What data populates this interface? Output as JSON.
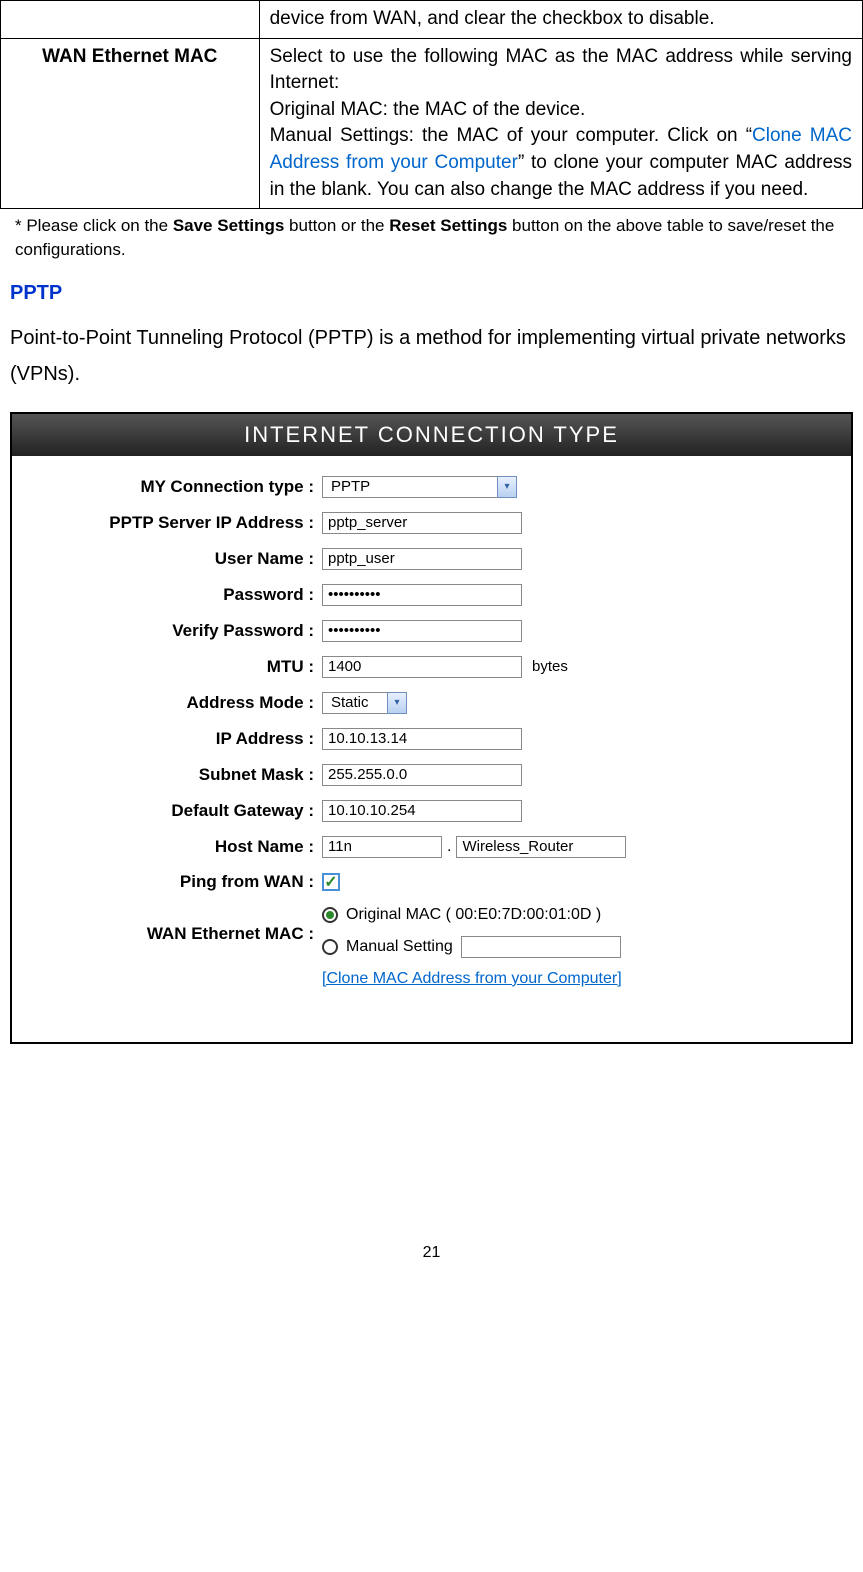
{
  "table": {
    "row1_desc": "device from WAN, and clear the checkbox to disable.",
    "row2_label": "WAN Ethernet MAC",
    "row2_desc_part1": "Select to use the following MAC as the MAC address while serving Internet:",
    "row2_desc_part2": "Original MAC: the MAC of the device.",
    "row2_desc_part3a": "Manual Settings: the MAC of your computer. Click on “",
    "row2_link": "Clone MAC Address from your Computer",
    "row2_desc_part3b": "” to clone your computer MAC address in the blank. You can also change the MAC address if you need."
  },
  "note_part1": "* Please click on the ",
  "note_bold1": "Save Settings",
  "note_part2": " button or the ",
  "note_bold2": "Reset Settings",
  "note_part3": " button on the above table to save/reset the configurations.",
  "section_title": "PPTP",
  "section_desc": "Point-to-Point Tunneling Protocol (PPTP) is a method for implementing virtual private networks (VPNs).",
  "form": {
    "header": "INTERNET CONNECTION TYPE",
    "labels": {
      "connection_type": "MY Connection type :",
      "server_ip": "PPTP Server IP Address :",
      "username": "User Name :",
      "password": "Password :",
      "verify_password": "Verify Password :",
      "mtu": "MTU :",
      "address_mode": "Address Mode :",
      "ip_address": "IP Address :",
      "subnet_mask": "Subnet Mask :",
      "default_gateway": "Default Gateway :",
      "host_name": "Host Name :",
      "ping_wan": "Ping from WAN :",
      "wan_mac": "WAN Ethernet MAC :"
    },
    "values": {
      "connection_type": "PPTP",
      "server_ip": "pptp_server",
      "username": "pptp_user",
      "password": "••••••••••",
      "verify_password": "••••••••••",
      "mtu": "1400",
      "mtu_suffix": "bytes",
      "address_mode": "Static",
      "ip_address": "10.10.13.14",
      "subnet_mask": "255.255.0.0",
      "default_gateway": "10.10.10.254",
      "host_name1": "11n",
      "host_name_sep": ".",
      "host_name2": "Wireless_Router",
      "original_mac": "Original MAC ( 00:E0:7D:00:01:0D )",
      "manual_setting": "Manual Setting",
      "clone_link": "[Clone MAC Address from your Computer]"
    }
  },
  "page_number": "21"
}
